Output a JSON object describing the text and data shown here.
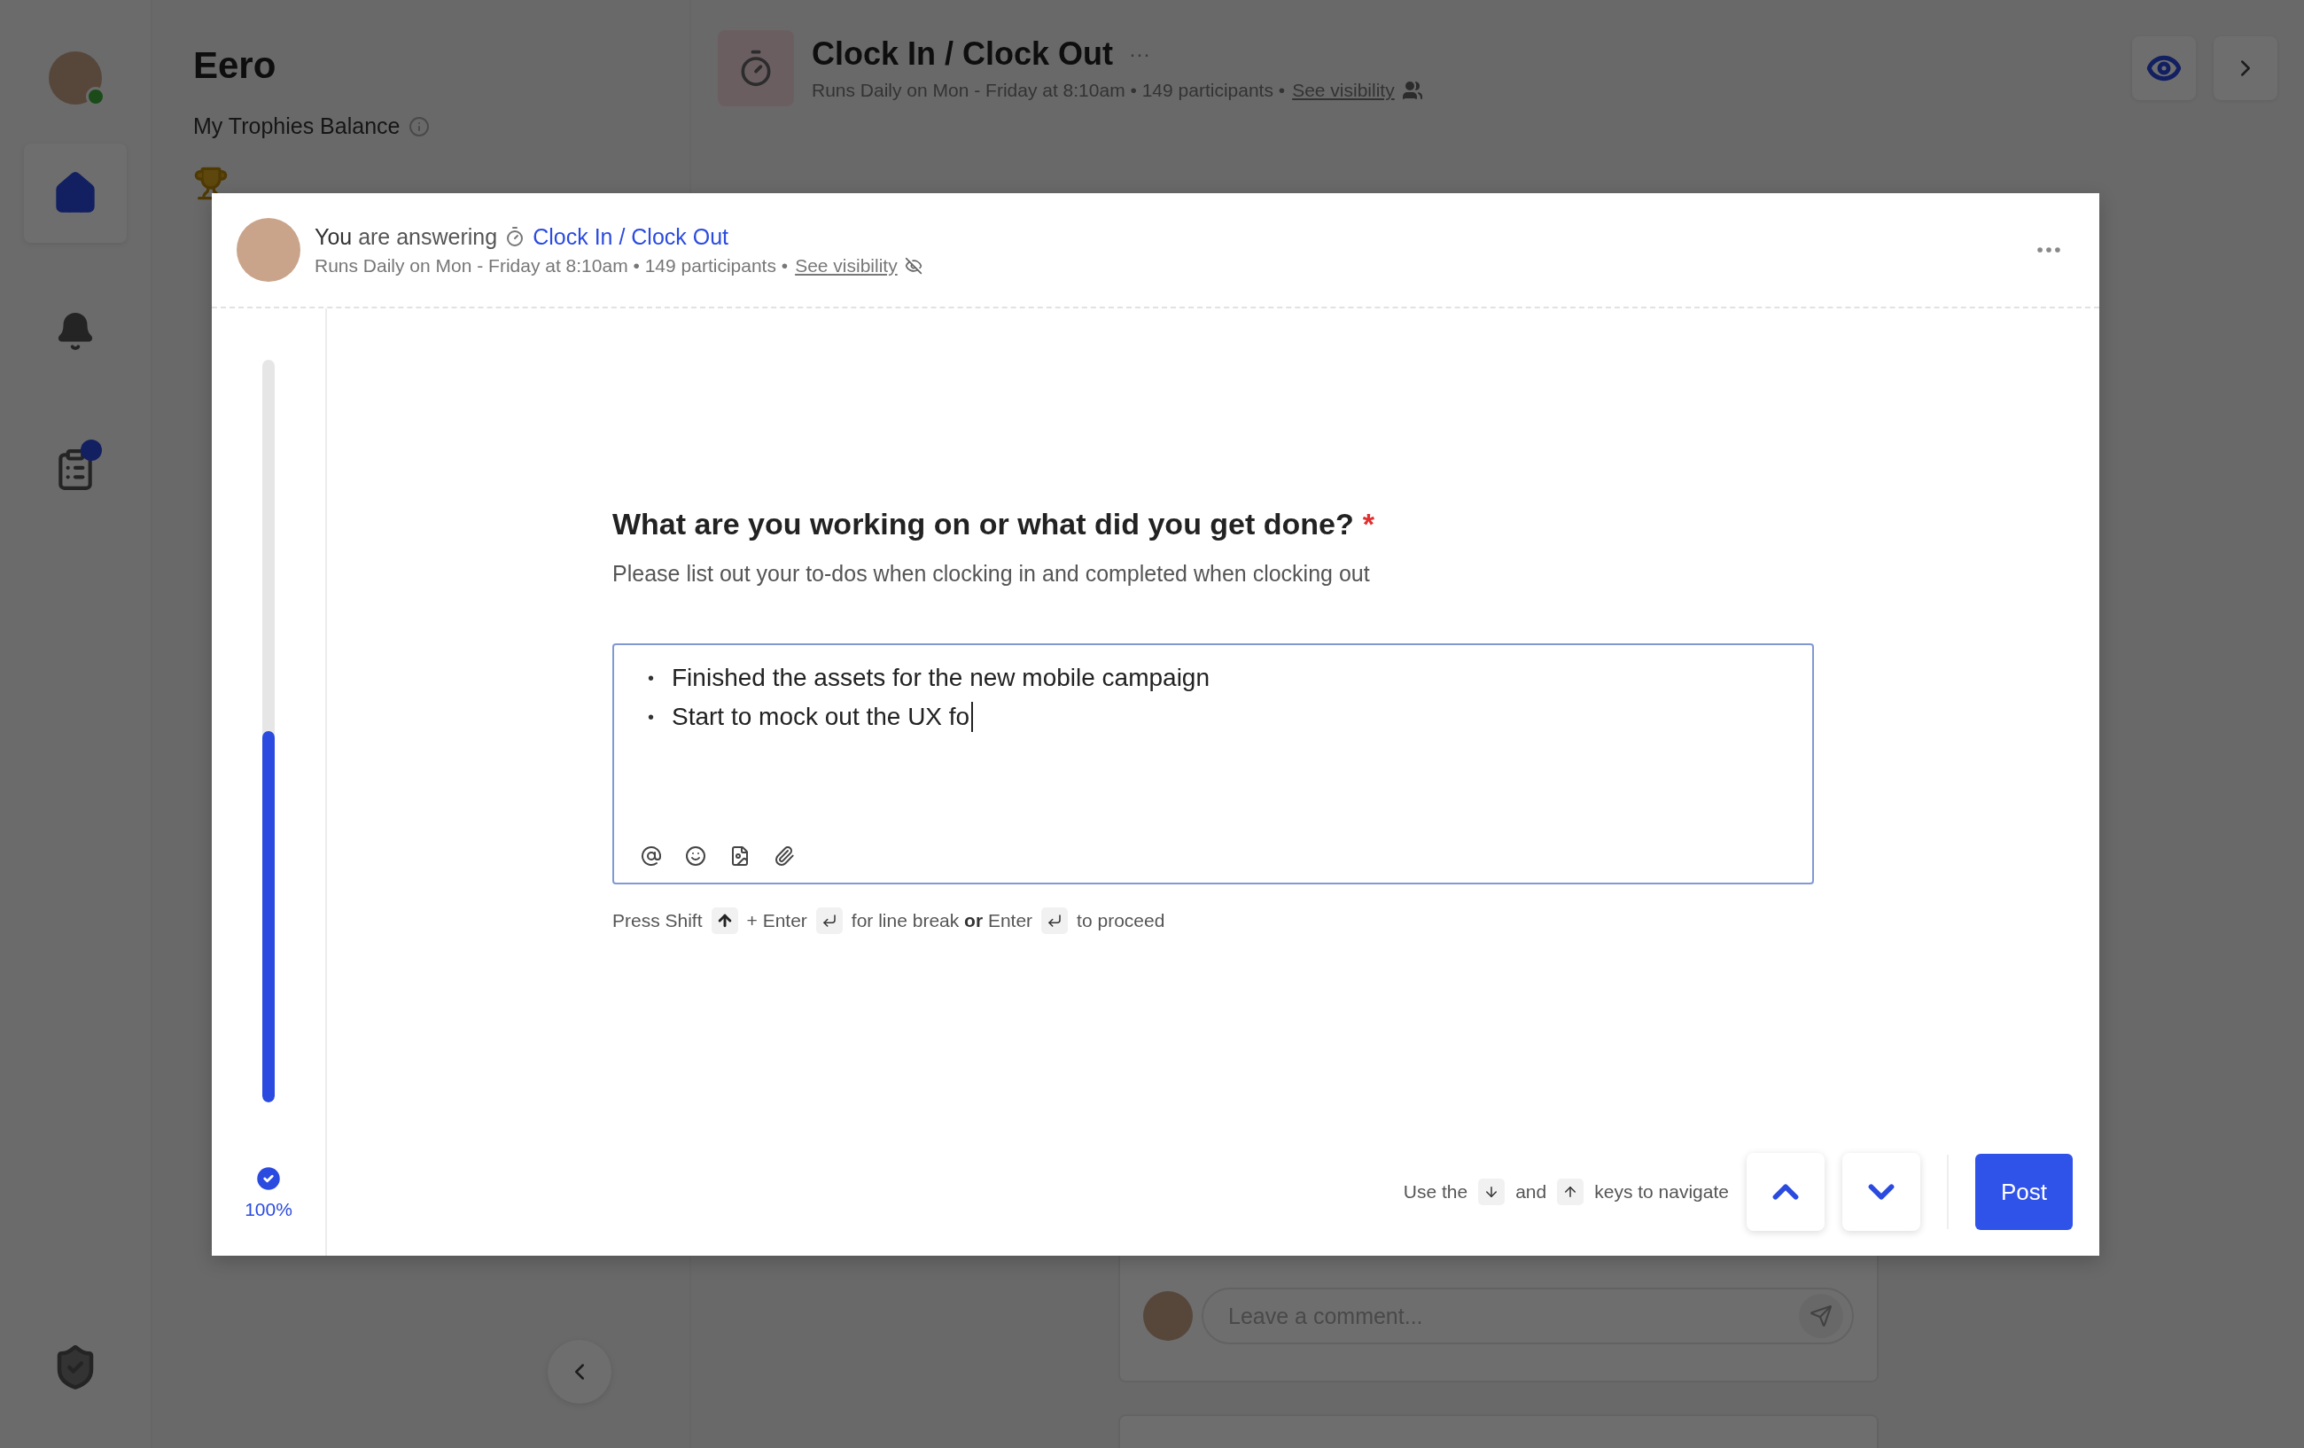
{
  "sidebar": {
    "online": true,
    "has_notification": true
  },
  "panel": {
    "title": "Eero",
    "balance_label": "My Trophies Balance"
  },
  "activity": {
    "title": "Clock In / Clock Out",
    "more": "···",
    "schedule": "Runs Daily on Mon - Friday at 8:10am • 149 participants •",
    "visibility_link": "See visibility"
  },
  "comment": {
    "placeholder": "Leave a comment..."
  },
  "modal": {
    "intro": "**You** are answering",
    "activity": "Clock In / Clock Out",
    "schedule": "Runs Daily on Mon - Friday at 8:10am • 149 participants •",
    "visibility_link": "See visibility",
    "progress": {
      "level": 0.5,
      "complete": true,
      "label": "100%"
    },
    "question": {
      "text": "What are you working on or what did you get done?",
      "required": true,
      "required_mark": "*"
    },
    "description": "Please list out your to-dos when clocking in and completed when clocking out",
    "answer": {
      "lines": [
        {
          "bullet": "•",
          "text": "Finished the assets for the new mobile campaign",
          "cursor": false
        },
        {
          "bullet": "•",
          "text": "Start to mock out the UX fo",
          "cursor": true
        }
      ]
    },
    "hint": [
      {
        "kind": "text",
        "text": "Press Shift"
      },
      {
        "kind": "shift-key"
      },
      {
        "kind": "text",
        "text": "+ Enter"
      },
      {
        "kind": "enter-key"
      },
      {
        "kind": "text",
        "text": "for line break **or** Enter"
      },
      {
        "kind": "enter-key"
      },
      {
        "kind": "text",
        "text": "to proceed"
      }
    ],
    "navigation": [
      {
        "kind": "text",
        "text": "Use the"
      },
      {
        "kind": "down-key"
      },
      {
        "kind": "text",
        "text": "and"
      },
      {
        "kind": "up-key"
      },
      {
        "kind": "text",
        "text": "keys to navigate"
      }
    ],
    "post_button": "Post"
  }
}
